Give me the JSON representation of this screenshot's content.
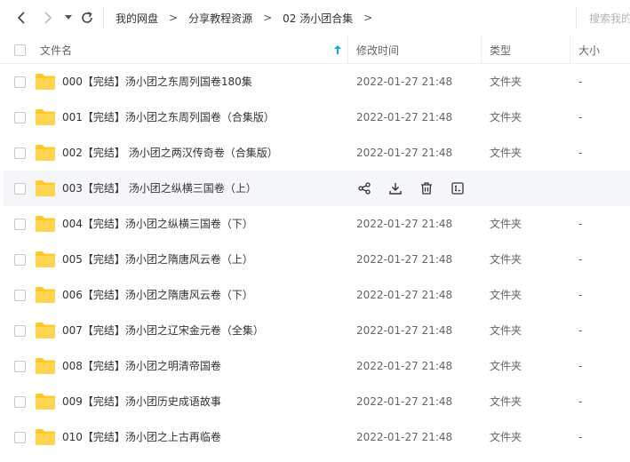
{
  "breadcrumb": [
    "我的网盘",
    "分享教程资源",
    "02 汤小团合集"
  ],
  "breadcrumb_arrow": ">",
  "search": {
    "placeholder": "搜索我的"
  },
  "columns": {
    "name": "文件名",
    "modified": "修改时间",
    "type": "类型",
    "size": "大小"
  },
  "sort_indicator": "↑",
  "hovered_row": 3,
  "rows": [
    {
      "name": "000【完结】汤小团之东周列国卷180集",
      "modified": "2022-01-27 21:48",
      "type": "文件夹",
      "size": "-"
    },
    {
      "name": "001【完结】汤小团之东周列国卷（合集版）",
      "modified": "2022-01-27 21:48",
      "type": "文件夹",
      "size": "-"
    },
    {
      "name": "002【完结】 汤小团之两汉传奇卷（合集版）",
      "modified": "2022-01-27 21:48",
      "type": "文件夹",
      "size": "-"
    },
    {
      "name": "003【完结】 汤小团之纵横三国卷（上）",
      "modified": "",
      "type": "",
      "size": ""
    },
    {
      "name": "004【完结】汤小团之纵横三国卷（下）",
      "modified": "2022-01-27 21:48",
      "type": "文件夹",
      "size": "-"
    },
    {
      "name": "005【完结】汤小团之隋唐风云卷（上）",
      "modified": "2022-01-27 21:48",
      "type": "文件夹",
      "size": "-"
    },
    {
      "name": "006【完结】汤小团之隋唐风云卷（下）",
      "modified": "2022-01-27 21:48",
      "type": "文件夹",
      "size": "-"
    },
    {
      "name": "007【完结】汤小团之辽宋金元卷（全集）",
      "modified": "2022-01-27 21:48",
      "type": "文件夹",
      "size": "-"
    },
    {
      "name": "008【完结】汤小团之明清帝国卷",
      "modified": "2022-01-27 21:48",
      "type": "文件夹",
      "size": "-"
    },
    {
      "name": "009【完结】汤小团历史成语故事",
      "modified": "2022-01-27 21:48",
      "type": "文件夹",
      "size": "-"
    },
    {
      "name": "010【完结】汤小团之上古再临卷",
      "modified": "2022-01-27 21:48",
      "type": "文件夹",
      "size": "-"
    }
  ],
  "row_actions": [
    "share-icon",
    "download-icon",
    "delete-icon",
    "rename-icon"
  ],
  "colors": {
    "folder": "#FFCA28",
    "accent": "#06a7ff",
    "hover": "#f5f6f9"
  }
}
